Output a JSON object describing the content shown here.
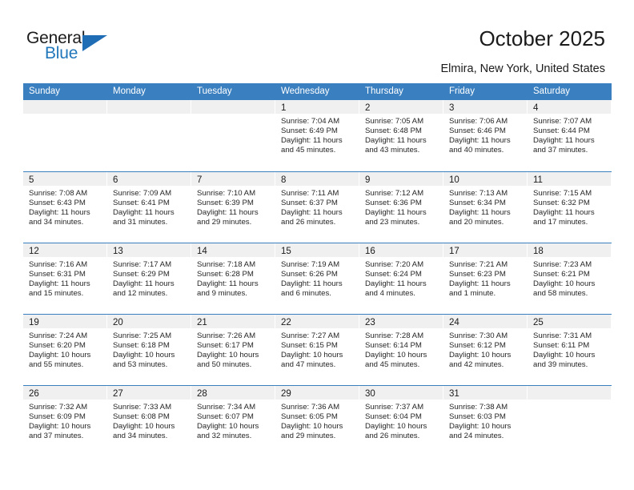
{
  "logo": {
    "word_top": "General",
    "word_bottom": "Blue",
    "accent_color": "#2277bb",
    "triangle_color": "#1f6db5"
  },
  "header": {
    "title": "October 2025",
    "location": "Elmira, New York, United States"
  },
  "calendar": {
    "header_bg": "#3a7fbf",
    "daynum_bg": "#f0f0f0",
    "weekdays": [
      "Sunday",
      "Monday",
      "Tuesday",
      "Wednesday",
      "Thursday",
      "Friday",
      "Saturday"
    ],
    "weeks": [
      [
        {
          "day": "",
          "empty": true
        },
        {
          "day": "",
          "empty": true
        },
        {
          "day": "",
          "empty": true
        },
        {
          "day": "1",
          "sunrise": "Sunrise: 7:04 AM",
          "sunset": "Sunset: 6:49 PM",
          "daylight_line1": "Daylight: 11 hours",
          "daylight_line2": "and 45 minutes."
        },
        {
          "day": "2",
          "sunrise": "Sunrise: 7:05 AM",
          "sunset": "Sunset: 6:48 PM",
          "daylight_line1": "Daylight: 11 hours",
          "daylight_line2": "and 43 minutes."
        },
        {
          "day": "3",
          "sunrise": "Sunrise: 7:06 AM",
          "sunset": "Sunset: 6:46 PM",
          "daylight_line1": "Daylight: 11 hours",
          "daylight_line2": "and 40 minutes."
        },
        {
          "day": "4",
          "sunrise": "Sunrise: 7:07 AM",
          "sunset": "Sunset: 6:44 PM",
          "daylight_line1": "Daylight: 11 hours",
          "daylight_line2": "and 37 minutes."
        }
      ],
      [
        {
          "day": "5",
          "sunrise": "Sunrise: 7:08 AM",
          "sunset": "Sunset: 6:43 PM",
          "daylight_line1": "Daylight: 11 hours",
          "daylight_line2": "and 34 minutes."
        },
        {
          "day": "6",
          "sunrise": "Sunrise: 7:09 AM",
          "sunset": "Sunset: 6:41 PM",
          "daylight_line1": "Daylight: 11 hours",
          "daylight_line2": "and 31 minutes."
        },
        {
          "day": "7",
          "sunrise": "Sunrise: 7:10 AM",
          "sunset": "Sunset: 6:39 PM",
          "daylight_line1": "Daylight: 11 hours",
          "daylight_line2": "and 29 minutes."
        },
        {
          "day": "8",
          "sunrise": "Sunrise: 7:11 AM",
          "sunset": "Sunset: 6:37 PM",
          "daylight_line1": "Daylight: 11 hours",
          "daylight_line2": "and 26 minutes."
        },
        {
          "day": "9",
          "sunrise": "Sunrise: 7:12 AM",
          "sunset": "Sunset: 6:36 PM",
          "daylight_line1": "Daylight: 11 hours",
          "daylight_line2": "and 23 minutes."
        },
        {
          "day": "10",
          "sunrise": "Sunrise: 7:13 AM",
          "sunset": "Sunset: 6:34 PM",
          "daylight_line1": "Daylight: 11 hours",
          "daylight_line2": "and 20 minutes."
        },
        {
          "day": "11",
          "sunrise": "Sunrise: 7:15 AM",
          "sunset": "Sunset: 6:32 PM",
          "daylight_line1": "Daylight: 11 hours",
          "daylight_line2": "and 17 minutes."
        }
      ],
      [
        {
          "day": "12",
          "sunrise": "Sunrise: 7:16 AM",
          "sunset": "Sunset: 6:31 PM",
          "daylight_line1": "Daylight: 11 hours",
          "daylight_line2": "and 15 minutes."
        },
        {
          "day": "13",
          "sunrise": "Sunrise: 7:17 AM",
          "sunset": "Sunset: 6:29 PM",
          "daylight_line1": "Daylight: 11 hours",
          "daylight_line2": "and 12 minutes."
        },
        {
          "day": "14",
          "sunrise": "Sunrise: 7:18 AM",
          "sunset": "Sunset: 6:28 PM",
          "daylight_line1": "Daylight: 11 hours",
          "daylight_line2": "and 9 minutes."
        },
        {
          "day": "15",
          "sunrise": "Sunrise: 7:19 AM",
          "sunset": "Sunset: 6:26 PM",
          "daylight_line1": "Daylight: 11 hours",
          "daylight_line2": "and 6 minutes."
        },
        {
          "day": "16",
          "sunrise": "Sunrise: 7:20 AM",
          "sunset": "Sunset: 6:24 PM",
          "daylight_line1": "Daylight: 11 hours",
          "daylight_line2": "and 4 minutes."
        },
        {
          "day": "17",
          "sunrise": "Sunrise: 7:21 AM",
          "sunset": "Sunset: 6:23 PM",
          "daylight_line1": "Daylight: 11 hours",
          "daylight_line2": "and 1 minute."
        },
        {
          "day": "18",
          "sunrise": "Sunrise: 7:23 AM",
          "sunset": "Sunset: 6:21 PM",
          "daylight_line1": "Daylight: 10 hours",
          "daylight_line2": "and 58 minutes."
        }
      ],
      [
        {
          "day": "19",
          "sunrise": "Sunrise: 7:24 AM",
          "sunset": "Sunset: 6:20 PM",
          "daylight_line1": "Daylight: 10 hours",
          "daylight_line2": "and 55 minutes."
        },
        {
          "day": "20",
          "sunrise": "Sunrise: 7:25 AM",
          "sunset": "Sunset: 6:18 PM",
          "daylight_line1": "Daylight: 10 hours",
          "daylight_line2": "and 53 minutes."
        },
        {
          "day": "21",
          "sunrise": "Sunrise: 7:26 AM",
          "sunset": "Sunset: 6:17 PM",
          "daylight_line1": "Daylight: 10 hours",
          "daylight_line2": "and 50 minutes."
        },
        {
          "day": "22",
          "sunrise": "Sunrise: 7:27 AM",
          "sunset": "Sunset: 6:15 PM",
          "daylight_line1": "Daylight: 10 hours",
          "daylight_line2": "and 47 minutes."
        },
        {
          "day": "23",
          "sunrise": "Sunrise: 7:28 AM",
          "sunset": "Sunset: 6:14 PM",
          "daylight_line1": "Daylight: 10 hours",
          "daylight_line2": "and 45 minutes."
        },
        {
          "day": "24",
          "sunrise": "Sunrise: 7:30 AM",
          "sunset": "Sunset: 6:12 PM",
          "daylight_line1": "Daylight: 10 hours",
          "daylight_line2": "and 42 minutes."
        },
        {
          "day": "25",
          "sunrise": "Sunrise: 7:31 AM",
          "sunset": "Sunset: 6:11 PM",
          "daylight_line1": "Daylight: 10 hours",
          "daylight_line2": "and 39 minutes."
        }
      ],
      [
        {
          "day": "26",
          "sunrise": "Sunrise: 7:32 AM",
          "sunset": "Sunset: 6:09 PM",
          "daylight_line1": "Daylight: 10 hours",
          "daylight_line2": "and 37 minutes."
        },
        {
          "day": "27",
          "sunrise": "Sunrise: 7:33 AM",
          "sunset": "Sunset: 6:08 PM",
          "daylight_line1": "Daylight: 10 hours",
          "daylight_line2": "and 34 minutes."
        },
        {
          "day": "28",
          "sunrise": "Sunrise: 7:34 AM",
          "sunset": "Sunset: 6:07 PM",
          "daylight_line1": "Daylight: 10 hours",
          "daylight_line2": "and 32 minutes."
        },
        {
          "day": "29",
          "sunrise": "Sunrise: 7:36 AM",
          "sunset": "Sunset: 6:05 PM",
          "daylight_line1": "Daylight: 10 hours",
          "daylight_line2": "and 29 minutes."
        },
        {
          "day": "30",
          "sunrise": "Sunrise: 7:37 AM",
          "sunset": "Sunset: 6:04 PM",
          "daylight_line1": "Daylight: 10 hours",
          "daylight_line2": "and 26 minutes."
        },
        {
          "day": "31",
          "sunrise": "Sunrise: 7:38 AM",
          "sunset": "Sunset: 6:03 PM",
          "daylight_line1": "Daylight: 10 hours",
          "daylight_line2": "and 24 minutes."
        },
        {
          "day": "",
          "empty": true
        }
      ]
    ]
  }
}
